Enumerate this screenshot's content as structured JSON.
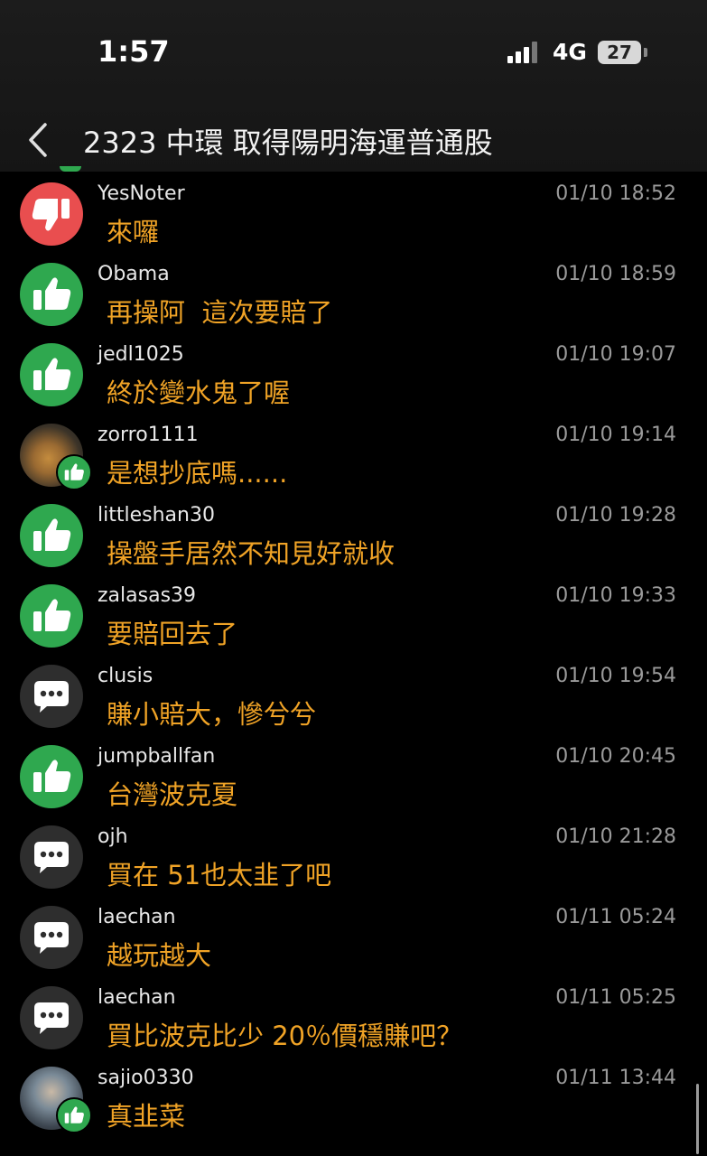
{
  "status_bar": {
    "time": "1:57",
    "network": "4G",
    "battery": "27"
  },
  "header": {
    "title": "2323 中環 取得陽明海運普通股"
  },
  "colors": {
    "username": "#e8e8e8",
    "message": "#f0a326",
    "timestamp": "#9a9a9a",
    "like": "#2fa84f",
    "dislike": "#e94e4f"
  },
  "comments": [
    {
      "username": "YesNoter",
      "time": "01/10 18:52",
      "text": "來囉",
      "avatar": "thumbs-down-icon"
    },
    {
      "username": "Obama",
      "time": "01/10 18:59",
      "text": "再操阿  這次要賠了",
      "avatar": "thumbs-up-icon"
    },
    {
      "username": "jedl1025",
      "time": "01/10 19:07",
      "text": "終於變水鬼了喔",
      "avatar": "thumbs-up-icon"
    },
    {
      "username": "zorro1111",
      "time": "01/10 19:14",
      "text": "是想抄底嗎......",
      "avatar": "user-photo-dog"
    },
    {
      "username": "littleshan30",
      "time": "01/10 19:28",
      "text": "操盤手居然不知見好就收",
      "avatar": "thumbs-up-icon"
    },
    {
      "username": "zalasas39",
      "time": "01/10 19:33",
      "text": "要賠回去了",
      "avatar": "thumbs-up-icon"
    },
    {
      "username": "clusis",
      "time": "01/10 19:54",
      "text": "賺小賠大，慘兮兮",
      "avatar": "chat-bubble-icon"
    },
    {
      "username": "jumpballfan",
      "time": "01/10 20:45",
      "text": "台灣波克夏",
      "avatar": "thumbs-up-icon"
    },
    {
      "username": "ojh",
      "time": "01/10 21:28",
      "text": "買在 51也太韭了吧",
      "avatar": "chat-bubble-icon"
    },
    {
      "username": "laechan",
      "time": "01/11 05:24",
      "text": "越玩越大",
      "avatar": "chat-bubble-icon"
    },
    {
      "username": "laechan",
      "time": "01/11 05:25",
      "text": "買比波克比少 20％價穩賺吧？",
      "avatar": "chat-bubble-icon"
    },
    {
      "username": "sajio0330",
      "time": "01/11 13:44",
      "text": "真韭菜",
      "avatar": "user-photo-person"
    }
  ]
}
